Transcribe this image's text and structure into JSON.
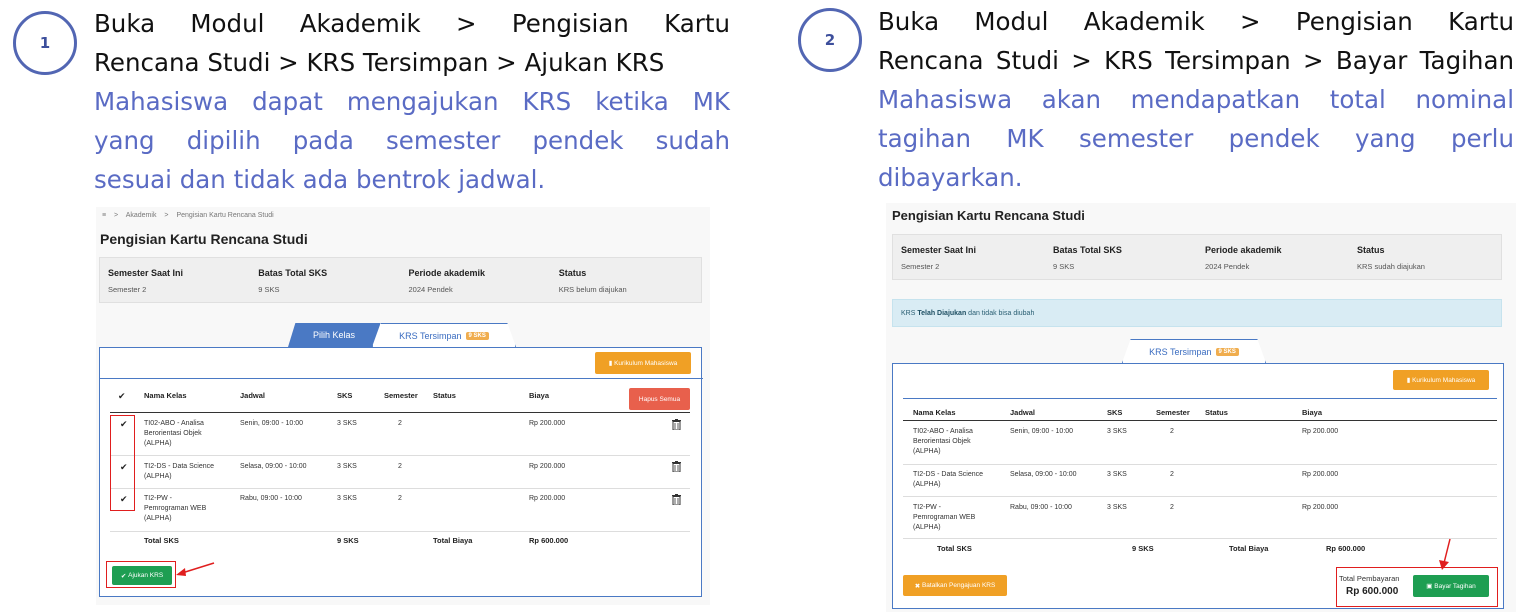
{
  "steps": [
    {
      "number": "1",
      "path_lines": [
        "Buka Modul Akademik > Pengisian Kartu",
        "Rencana Studi > KRS Tersimpan > Ajukan KRS"
      ],
      "desc_lines": [
        "Mahasiswa dapat mengajukan KRS ketika MK",
        "yang dipilih pada semester pendek sudah",
        "sesuai dan tidak ada bentrok jadwal."
      ]
    },
    {
      "number": "2",
      "path_lines": [
        "Buka Modul Akademik > Pengisian Kartu",
        "Rencana Studi > KRS Tersimpan > Bayar Tagihan"
      ],
      "desc_lines": [
        "Mahasiswa akan mendapatkan total nominal",
        "tagihan MK semester pendek yang perlu",
        "dibayarkan."
      ]
    }
  ],
  "shot1": {
    "breadcrumb": [
      "≡",
      ">",
      "Akademik",
      ">",
      "Pengisian Kartu Rencana Studi"
    ],
    "title": "Pengisian Kartu Rencana Studi",
    "info": [
      {
        "label": "Semester Saat Ini",
        "value": "Semester 2"
      },
      {
        "label": "Batas Total SKS",
        "value": "9 SKS"
      },
      {
        "label": "Periode akademik",
        "value": "2024 Pendek"
      },
      {
        "label": "Status",
        "value": "KRS belum diajukan"
      }
    ],
    "tab_pilih": "Pilih Kelas",
    "tab_krs": "KRS Tersimpan",
    "tab_badge": "9 SKS",
    "kurikulum_btn": "Kurikulum Mahasiswa",
    "hapus_btn": "Hapus Semua",
    "headers": [
      "Nama Kelas",
      "Jadwal",
      "SKS",
      "Semester",
      "Status",
      "Biaya"
    ],
    "rows": [
      {
        "nama": [
          "TI02-ABO - Analisa",
          "Berorientasi Objek",
          "(ALPHA)"
        ],
        "jadwal": "Senin, 09:00 - 10:00",
        "sks": "3 SKS",
        "semester": "2",
        "biaya": "Rp 200.000"
      },
      {
        "nama": [
          "TI2-DS - Data Science",
          "(ALPHA)"
        ],
        "jadwal": "Selasa, 09:00 - 10:00",
        "sks": "3 SKS",
        "semester": "2",
        "biaya": "Rp 200.000"
      },
      {
        "nama": [
          "TI2-PW -",
          "Pemrograman WEB",
          "(ALPHA)"
        ],
        "jadwal": "Rabu, 09:00 - 10:00",
        "sks": "3 SKS",
        "semester": "2",
        "biaya": "Rp 200.000"
      }
    ],
    "total_sks_label": "Total SKS",
    "total_sks": "9 SKS",
    "total_biaya_label": "Total Biaya",
    "total_biaya": "Rp 600.000",
    "ajukan_btn": "Ajukan KRS"
  },
  "shot2": {
    "title": "Pengisian Kartu Rencana Studi",
    "info": [
      {
        "label": "Semester Saat Ini",
        "value": "Semester 2"
      },
      {
        "label": "Batas Total SKS",
        "value": "9 SKS"
      },
      {
        "label": "Periode akademik",
        "value": "2024 Pendek"
      },
      {
        "label": "Status",
        "value": "KRS sudah diajukan"
      }
    ],
    "alert_pre": "KRS ",
    "alert_bold": "Telah Diajukan",
    "alert_post": " dan tidak bisa diubah",
    "tab_krs": "KRS Tersimpan",
    "tab_badge": "9 SKS",
    "kurikulum_btn": "Kurikulum Mahasiswa",
    "headers": [
      "Nama Kelas",
      "Jadwal",
      "SKS",
      "Semester",
      "Status",
      "Biaya"
    ],
    "rows": [
      {
        "nama": [
          "TI02-ABO - Analisa",
          "Berorientasi Objek",
          "(ALPHA)"
        ],
        "jadwal": "Senin, 09:00 - 10:00",
        "sks": "3 SKS",
        "semester": "2",
        "biaya": "Rp 200.000"
      },
      {
        "nama": [
          "TI2-DS - Data Science",
          "(ALPHA)"
        ],
        "jadwal": "Selasa, 09:00 - 10:00",
        "sks": "3 SKS",
        "semester": "2",
        "biaya": "Rp 200.000"
      },
      {
        "nama": [
          "TI2-PW -",
          "Pemrograman WEB",
          "(ALPHA)"
        ],
        "jadwal": "Rabu, 09:00 - 10:00",
        "sks": "3 SKS",
        "semester": "2",
        "biaya": "Rp 200.000"
      }
    ],
    "total_sks_label": "Total SKS",
    "total_sks": "9 SKS",
    "total_biaya_label": "Total Biaya",
    "total_biaya": "Rp 600.000",
    "batalkan_btn": "Batalkan Pengajuan KRS",
    "total_pembayaran_label": "Total Pembayaran",
    "total_pembayaran": "Rp 600.000",
    "bayar_btn": "Bayar Tagihan"
  },
  "colors": {
    "accent": "#5266b3",
    "desc": "#5a6bc4",
    "highlight": "#e01e1e"
  }
}
